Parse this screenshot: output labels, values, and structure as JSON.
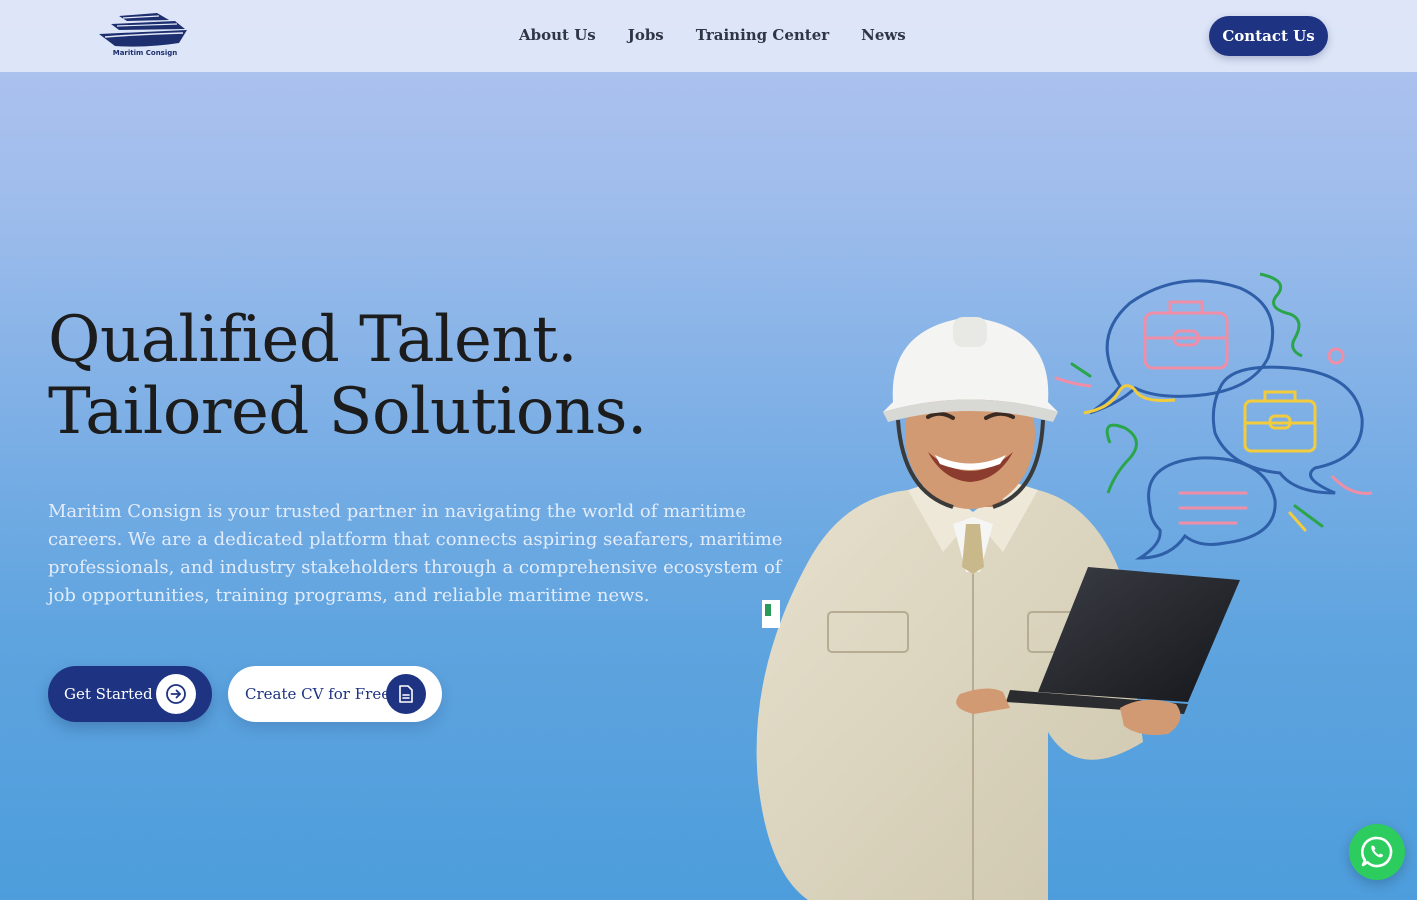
{
  "header": {
    "logo_text": "Maritim Consign",
    "nav": [
      "About Us",
      "Jobs",
      "Training Center",
      "News"
    ],
    "contact_label": "Contact Us"
  },
  "hero": {
    "title_line1": "Qualified Talent.",
    "title_line2": "Tailored Solutions.",
    "description": "Maritim Consign is your trusted partner in navigating the world of maritime careers. We are a dedicated platform that connects aspiring seafarers, maritime professionals, and industry stakeholders through a comprehensive ecosystem of job opportunities, training programs, and reliable maritime news.",
    "primary_button": "Get Started",
    "secondary_button": "Create CV for Free"
  },
  "icons": {
    "primary_button_icon": "arrow-right-circle-icon",
    "secondary_button_icon": "document-icon",
    "floating": "whatsapp-icon"
  },
  "colors": {
    "brand": "#1e3382",
    "whatsapp": "#2dcc5e"
  }
}
